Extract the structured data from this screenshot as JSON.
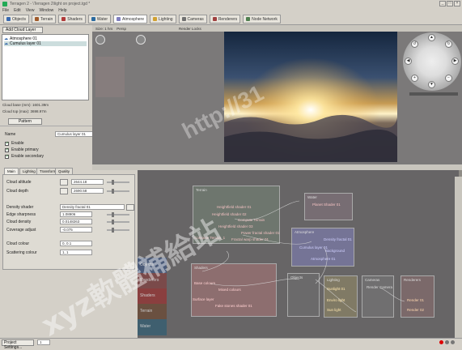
{
  "window": {
    "title": "Terragen 2 - \\Terragen 2\\light on project.tgd *"
  },
  "menu": [
    "File",
    "Edit",
    "View",
    "Window",
    "Help"
  ],
  "toolbar": [
    {
      "label": "Objects",
      "color": "#3a6ab0"
    },
    {
      "label": "Terrain",
      "color": "#a05a2a"
    },
    {
      "label": "Shaders",
      "color": "#b03a3a"
    },
    {
      "label": "Water",
      "color": "#2a6aa0"
    },
    {
      "label": "Atmosphere",
      "color": "#8080c0",
      "active": true
    },
    {
      "label": "Lighting",
      "color": "#d0a030"
    },
    {
      "label": "Cameras",
      "color": "#707070"
    },
    {
      "label": "Renderers",
      "color": "#a04040"
    },
    {
      "label": "Node Network",
      "color": "#508050"
    }
  ],
  "left": {
    "add_label": "Add Cloud Layer",
    "tree": [
      {
        "label": "Atmosphere 01",
        "selected": false
      },
      {
        "label": "Cumulus layer 01",
        "selected": true
      }
    ],
    "cloud_base": "Cloud base (mm): 1601.39m",
    "cloud_top": "Cloud top (max): 3698.97m",
    "pattern_label": "Pattern"
  },
  "props": {
    "name_label": "Name",
    "name_value": "Cumulus layer 01",
    "enable": "Enable",
    "enable_primary": "Enable primary",
    "enable_secondary": "Enable secondary",
    "tabs": [
      "Main",
      "Lighting",
      "Transform",
      "Quality"
    ],
    "rows": [
      {
        "label": "Cloud altitude",
        "value": "2644.18"
      },
      {
        "label": "Cloud depth",
        "value": "2690.58"
      },
      {
        "label": "Density shader",
        "value": "Density fractal 01"
      },
      {
        "label": "Edge sharpness",
        "value": "1.08906"
      },
      {
        "label": "Cloud density",
        "value": "0.0148263"
      },
      {
        "label": "Coverage adjust",
        "value": "-0.075"
      },
      {
        "label": "Cloud colour",
        "value": "0, 0.1"
      },
      {
        "label": "Scattering colour",
        "value": "1, 1"
      }
    ],
    "project_settings": "Project Settings...",
    "frame": "1"
  },
  "viewport": {
    "size_label": "Size: 1 hrs",
    "mode_label": "Persp",
    "render_label": "Render Locks"
  },
  "nodes": {
    "categories": [
      "Objects",
      "Renderers",
      "Shaders",
      "Terrain",
      "Water"
    ],
    "terrain_title": "Terrain",
    "terrain_items": [
      "Heightfield shader 01",
      "Heightfield shader 02",
      "Compute Terrain",
      "Heightfield shader 03",
      "Power fractal shader 01",
      "Compute Terrain_1",
      "Fractal warp shader 01"
    ],
    "water_title": "Water",
    "water_items": [
      "Planet Shader 01"
    ],
    "atmosphere_title": "Atmosphere",
    "atmosphere_items": [
      "Density fractal 01",
      "Cumulus layer 01",
      "Background",
      "Atmosphere 01"
    ],
    "shaders_title": "Shaders",
    "shaders_items": [
      "Base colours",
      "Mixed colours",
      "Surface layer",
      "Fake stones shader 01"
    ],
    "objects_title": "Objects",
    "lighting_title": "Lighting",
    "lighting_items": [
      "Sunlight 01",
      "Enviro light",
      "Sun light"
    ],
    "cameras_title": "Cameras",
    "cameras_items": [
      "Render Camera"
    ],
    "renderers_title": "Renderers",
    "renderers_items": [
      "Render 01",
      "Render 02"
    ]
  },
  "watermarks": {
    "url": "http://31",
    "brand": "xyz軟體補給站"
  }
}
